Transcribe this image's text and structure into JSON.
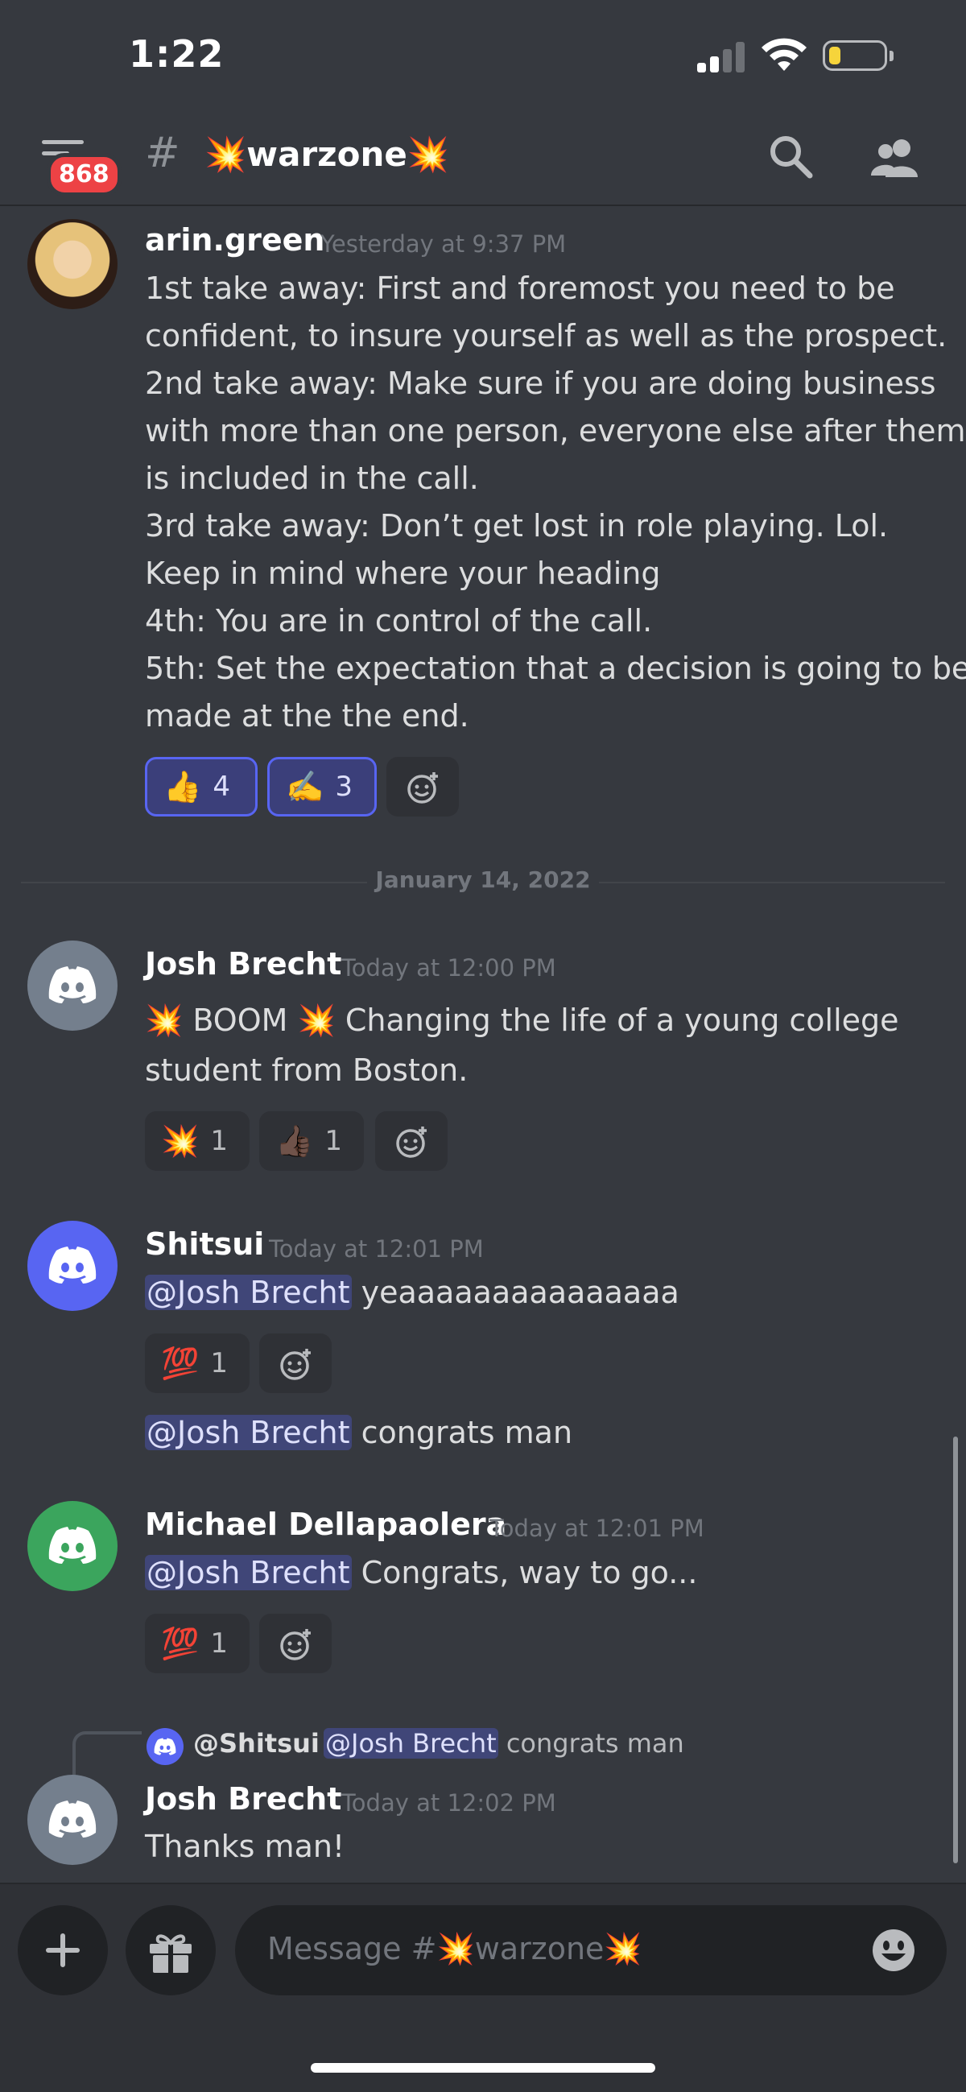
{
  "status_bar": {
    "time": "1:22"
  },
  "header": {
    "unread_badge": "868",
    "hash": "#",
    "channel_name": "💥warzone💥"
  },
  "messages": [
    {
      "author": "arin.green",
      "timestamp": "Yesterday at 9:37 PM",
      "lines": [
        "1st take away:  First and foremost you need to be",
        "confident, to insure yourself as well as the prospect.",
        "2nd take away: Make sure if you are doing business",
        "with more than one person, everyone else after them",
        "is included in the call.",
        "3rd take away: Don’t get lost in role playing. Lol.",
        "Keep in mind where your heading",
        "4th: You are in control of the call.",
        "5th: Set the expectation that a decision is going to be",
        "made at the the end."
      ],
      "reactions": [
        {
          "emoji": "👍",
          "count": "4"
        },
        {
          "emoji": "✍️",
          "count": "3"
        }
      ]
    },
    {
      "author": "Josh Brecht",
      "timestamp": "Today at 12:00 PM",
      "lines": [
        "💥 BOOM 💥 Changing the life of a young college",
        "student from Boston."
      ],
      "reactions": [
        {
          "emoji": "💥",
          "count": "1"
        },
        {
          "emoji": "👍🏿",
          "count": "1"
        }
      ]
    },
    {
      "author": "Shitsui",
      "timestamp": "Today at 12:01 PM",
      "mention": "@Josh Brecht",
      "text": " yeaaaaaaaaaaaaaaa",
      "reactions": [
        {
          "emoji": "💯",
          "count": "1"
        }
      ],
      "followup_mention": "@Josh Brecht",
      "followup_text": " congrats man"
    },
    {
      "author": "Michael Dellapaolera",
      "timestamp": "Today at 12:01 PM",
      "mention": "@Josh Brecht",
      "text": " Congrats, way to go...",
      "reactions": [
        {
          "emoji": "💯",
          "count": "1"
        }
      ]
    },
    {
      "reply": {
        "author": "@Shitsui",
        "mention": "@Josh Brecht",
        "text": " congrats man"
      },
      "author": "Josh Brecht",
      "timestamp": "Today at 12:02 PM",
      "text": "Thanks man!"
    }
  ],
  "date_divider": "January 14, 2022",
  "composer": {
    "placeholder": "Message #💥warzone💥"
  },
  "colors": {
    "background": "#36393f",
    "blurple": "#5865f2",
    "green": "#3ba55d",
    "grey_avatar": "#747f8d",
    "badge_red": "#ed4245"
  }
}
